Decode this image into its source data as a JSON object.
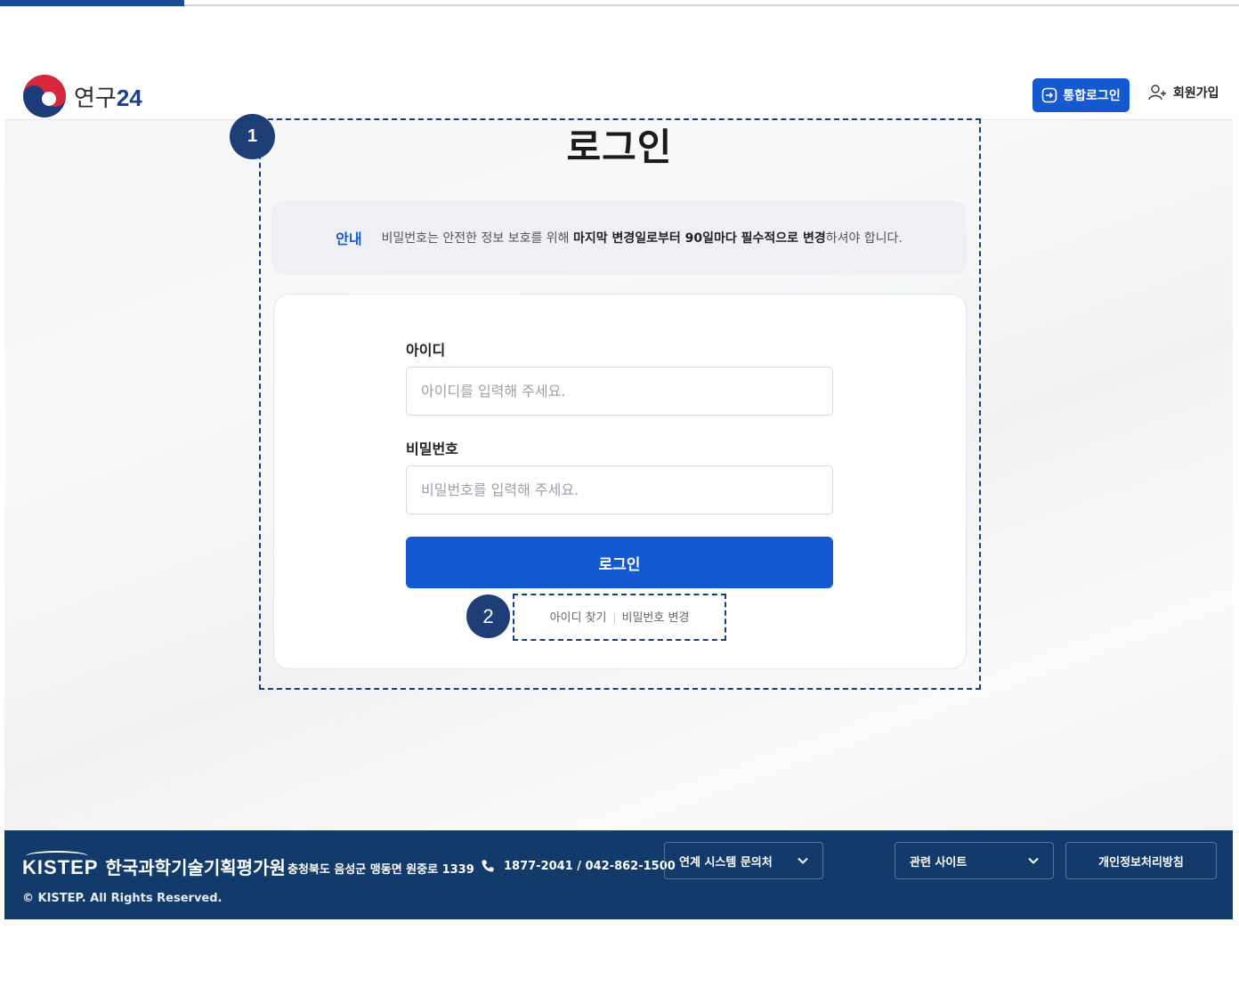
{
  "header": {
    "logo_text": "연구",
    "logo_number": "24",
    "sso_login_label": "통합로그인",
    "signup_label": "회원가입"
  },
  "page": {
    "title": "로그인"
  },
  "notice": {
    "tag": "안내",
    "text_before": "비밀번호는 안전한 정보 보호를 위해 ",
    "text_bold": "마지막 변경일로부터 90일마다 필수적으로 변경",
    "text_after": "하셔야 합니다."
  },
  "form": {
    "id_label": "아이디",
    "id_placeholder": "아이디를 입력해 주세요.",
    "password_label": "비밀번호",
    "password_placeholder": "비밀번호를 입력해 주세요.",
    "login_button": "로그인",
    "find_id_link": "아이디 찾기",
    "change_password_link": "비밀번호 변경"
  },
  "annotations": {
    "badge1": "1",
    "badge2": "2"
  },
  "footer": {
    "brand": "KISTEP",
    "org_name": "한국과학기술기획평가원",
    "address": "충청북도 음성군 맹동면 원중로 1339",
    "phone": "1877-2041 / 042-862-1500",
    "linked_systems_label": "연계 시스템 문의처",
    "related_sites_label": "관련 사이트",
    "privacy_policy_label": "개인정보처리방침",
    "copyright": "© KISTEP. All Rights Reserved."
  },
  "colors": {
    "primary": "#1459d0",
    "footer_bg": "#123a6b",
    "annotation": "#1d3f76"
  }
}
